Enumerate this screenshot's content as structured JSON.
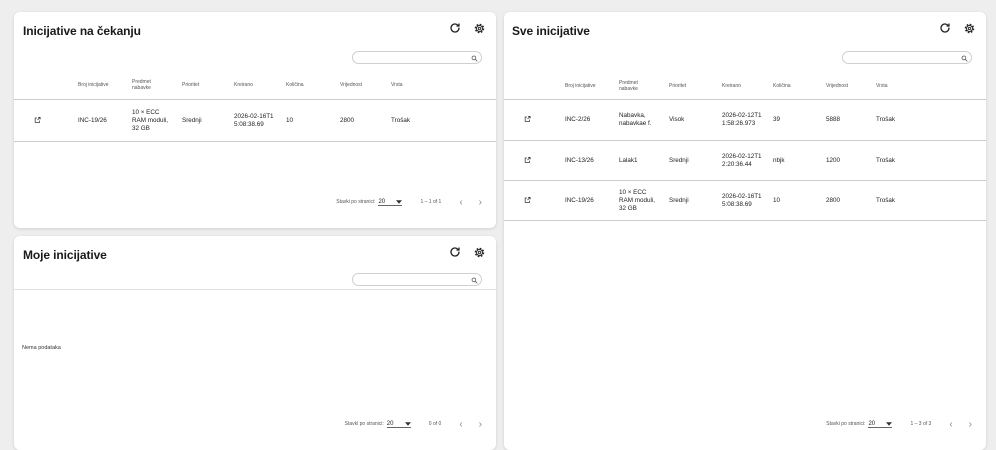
{
  "pending": {
    "title": "Inicijative na čekanju",
    "search_placeholder": "",
    "columns": [
      "Broj inicijative",
      "Predmet nabavke",
      "Prioritet",
      "Kreirano",
      "Količina",
      "Vrijednost",
      "Vrsta"
    ],
    "rows": [
      {
        "broj": "INC-19/26",
        "predmet": "10 × ECC RAM moduli, 32 GB",
        "prioritet": "Srednji",
        "kreirano": "2026-02-16T15:08:38.69",
        "kolicina": "10",
        "vrijednost": "2800",
        "vrsta": "Trošak"
      }
    ],
    "footer": {
      "per_page_label": "Stavki po stranici:",
      "per_page": "20",
      "range": "1 – 1 of 1"
    }
  },
  "mine": {
    "title": "Moje inicijative",
    "search_placeholder": "",
    "empty_text": "Nema podataka",
    "footer": {
      "per_page_label": "Stavki po stranici:",
      "per_page": "20",
      "range": "0 of 0"
    }
  },
  "all": {
    "title": "Sve inicijative",
    "search_placeholder": "",
    "columns": [
      "Broj inicijative",
      "Predmet nabavke",
      "Prioritet",
      "Kreirano",
      "Količina",
      "Vrijednost",
      "Vrsta"
    ],
    "rows": [
      {
        "broj": "INC-2/26",
        "predmet": "Nabavka, nabavkae f.",
        "prioritet": "Visok",
        "kreirano": "2026-02-12T11:58:26.973",
        "kolicina": "39",
        "vrijednost": "5888",
        "vrsta": "Trošak"
      },
      {
        "broj": "INC-13/26",
        "predmet": "Lalak1",
        "prioritet": "Srednji",
        "kreirano": "2026-02-12T12:20:36.44",
        "kolicina": "nbjk",
        "vrijednost": "1200",
        "vrsta": "Trošak"
      },
      {
        "broj": "INC-19/26",
        "predmet": "10 × ECC RAM moduli, 32 GB",
        "prioritet": "Srednji",
        "kreirano": "2026-02-16T15:08:38.69",
        "kolicina": "10",
        "vrijednost": "2800",
        "vrsta": "Trošak"
      }
    ],
    "footer": {
      "per_page_label": "Stavki po stranici:",
      "per_page": "20",
      "range": "1 – 3 of 3"
    }
  },
  "icons": {
    "refresh": "refresh-icon",
    "settings": "settings-gear-icon",
    "search": "search-icon",
    "open": "open-in-new-icon",
    "dropdown": "chevron-down-icon",
    "prev": "chevron-left-icon",
    "next": "chevron-right-icon"
  },
  "colors": {
    "background": "#eeeeee",
    "card": "#ffffff",
    "text": "#222222",
    "divider": "#cccccc"
  }
}
